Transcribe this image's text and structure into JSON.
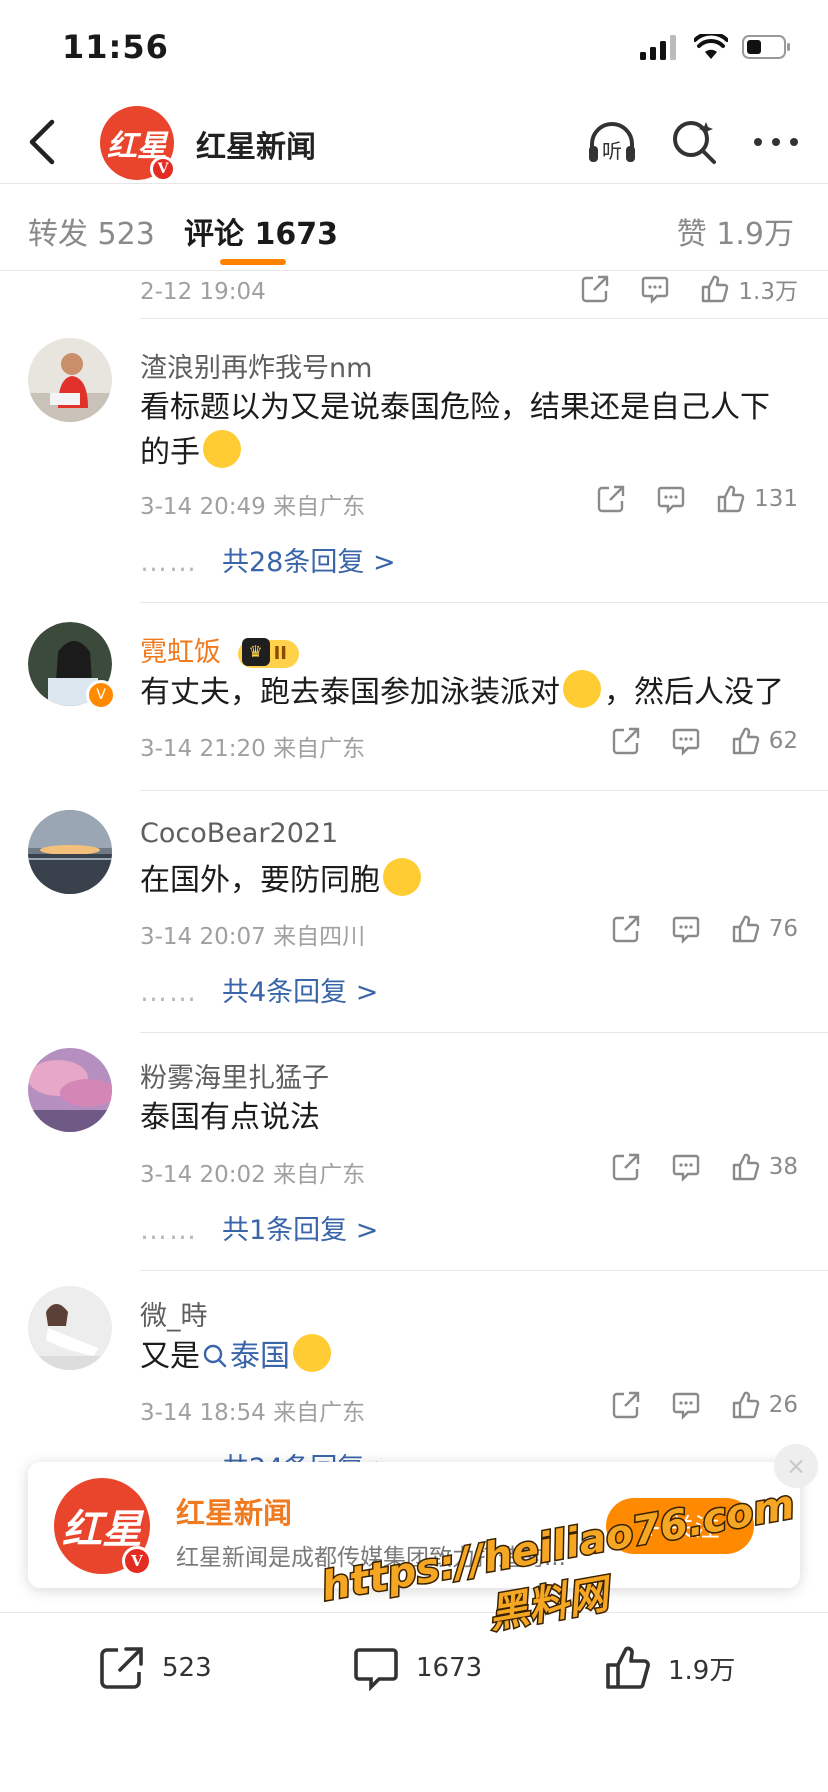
{
  "status_bar": {
    "time": "11:56"
  },
  "header": {
    "title": "红星新闻",
    "avatar_text": "红星",
    "listen_label": "听"
  },
  "tabs": {
    "repost": "转发 523",
    "comments": "评论 1673",
    "likes": "赞 1.9万"
  },
  "top_partial": {
    "time": "2-12 19:04",
    "likes": "1.3万"
  },
  "comments": [
    {
      "user": "渣浪别再炸我号nm",
      "text": "看标题以为又是说泰国危险，结果还是自己人下的手",
      "time": "3-14 20:49 来自广东",
      "likes": "131",
      "replies": "共28条回复 >"
    },
    {
      "user": "霓虹饭",
      "badge": "II",
      "text_before": "有丈夫，跑去泰国参加泳装派对",
      "text_after": "，然后人没了",
      "time": "3-14 21:20 来自广东",
      "likes": "62"
    },
    {
      "user": "CocoBear2021",
      "text": "在国外，要防同胞",
      "time": "3-14 20:07 来自四川",
      "likes": "76",
      "replies": "共4条回复 >"
    },
    {
      "user": "粉雾海里扎猛子",
      "text": "泰国有点说法",
      "time": "3-14 20:02 来自广东",
      "likes": "38",
      "replies": "共1条回复 >"
    },
    {
      "user": "微_時",
      "text_before": "又是",
      "link": "泰国",
      "time": "3-14 18:54 来自广东",
      "likes": "26",
      "replies": "共24条回复 >"
    }
  ],
  "follow_card": {
    "name": "红星新闻",
    "desc": "红星新闻是成都传媒集团致力打造的...",
    "follow": "+ 关注",
    "close": "×"
  },
  "bottom_bar": {
    "repost": "523",
    "comments": "1673",
    "likes": "1.9万"
  },
  "watermark": {
    "url": "https://heiliao76.com",
    "name": "黑料网"
  },
  "colors": {
    "accent": "#ff8200",
    "link": "#3a65a8",
    "vip": "#f07a1f"
  }
}
